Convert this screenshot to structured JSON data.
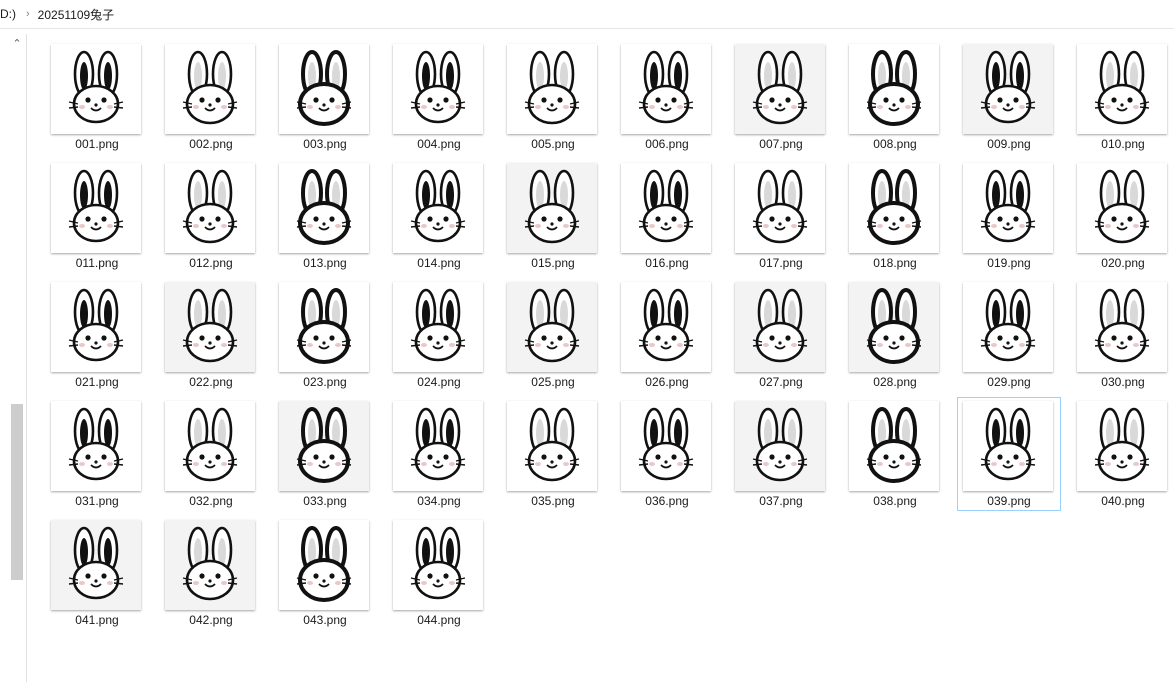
{
  "address": {
    "drive": "D:)",
    "chevron_icon": "chevron-right-icon",
    "folder": "20251109兔子"
  },
  "scrollbar": {
    "up_icon": "chevron-up-icon"
  },
  "files": [
    {
      "name": "001.png"
    },
    {
      "name": "002.png"
    },
    {
      "name": "003.png"
    },
    {
      "name": "004.png"
    },
    {
      "name": "005.png"
    },
    {
      "name": "006.png"
    },
    {
      "name": "007.png"
    },
    {
      "name": "008.png"
    },
    {
      "name": "009.png"
    },
    {
      "name": "010.png"
    },
    {
      "name": "011.png"
    },
    {
      "name": "012.png"
    },
    {
      "name": "013.png"
    },
    {
      "name": "014.png"
    },
    {
      "name": "015.png"
    },
    {
      "name": "016.png"
    },
    {
      "name": "017.png"
    },
    {
      "name": "018.png"
    },
    {
      "name": "019.png"
    },
    {
      "name": "020.png"
    },
    {
      "name": "021.png"
    },
    {
      "name": "022.png"
    },
    {
      "name": "023.png"
    },
    {
      "name": "024.png"
    },
    {
      "name": "025.png"
    },
    {
      "name": "026.png"
    },
    {
      "name": "027.png"
    },
    {
      "name": "028.png"
    },
    {
      "name": "029.png"
    },
    {
      "name": "030.png"
    },
    {
      "name": "031.png"
    },
    {
      "name": "032.png"
    },
    {
      "name": "033.png"
    },
    {
      "name": "034.png"
    },
    {
      "name": "035.png"
    },
    {
      "name": "036.png"
    },
    {
      "name": "037.png"
    },
    {
      "name": "038.png"
    },
    {
      "name": "039.png",
      "selected": true
    },
    {
      "name": "040.png"
    },
    {
      "name": "041.png"
    },
    {
      "name": "042.png"
    },
    {
      "name": "043.png"
    },
    {
      "name": "044.png"
    }
  ]
}
